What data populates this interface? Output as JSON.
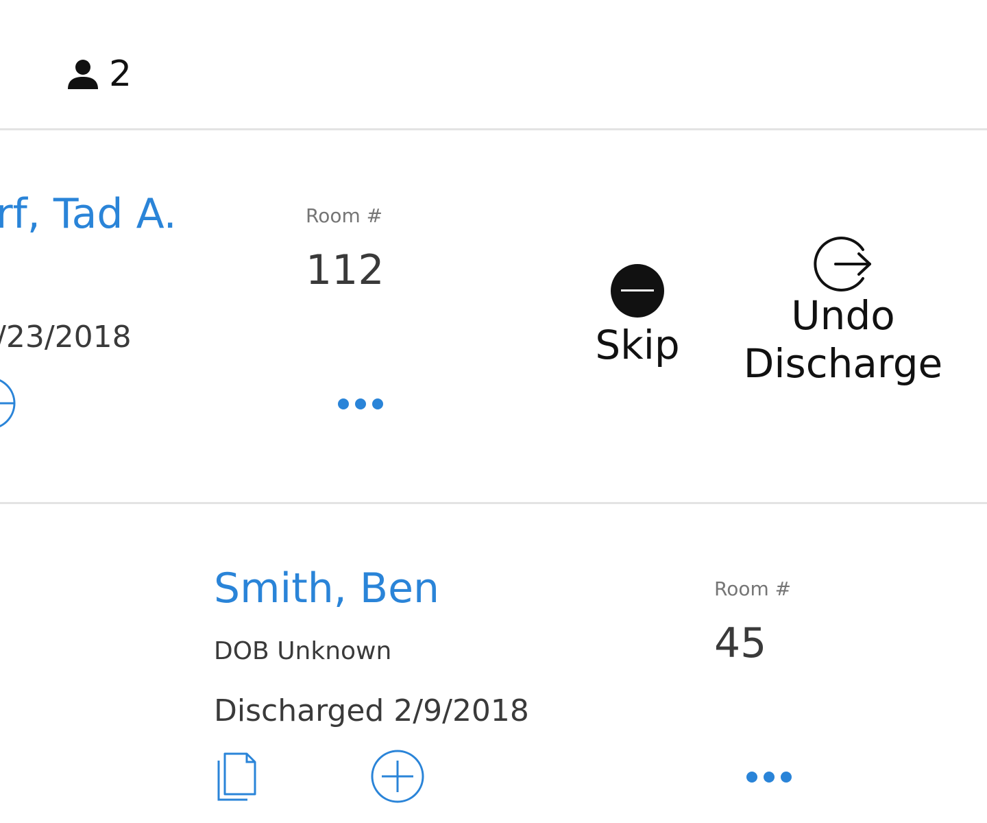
{
  "header": {
    "patient_count": "2"
  },
  "patients": [
    {
      "name": "rf, Tad A.",
      "room_label": "Room #",
      "room_value": "112",
      "date_partial": "/23/2018"
    },
    {
      "name": "Smith, Ben",
      "room_label": "Room #",
      "room_value": "45",
      "dob": "DOB Unknown",
      "discharged": "Discharged 2/9/2018"
    }
  ],
  "swipe_actions": {
    "skip_label": "Skip",
    "undo_line1": "Undo",
    "undo_line2": "Discharge"
  },
  "colors": {
    "accent": "#2a84d8",
    "divider": "#e3e3e3",
    "text": "#3a3a3a"
  },
  "icons": [
    "person-icon",
    "minus-circle-icon",
    "exit-arrow-icon",
    "documents-icon",
    "add-circle-icon",
    "more-dots-icon"
  ]
}
